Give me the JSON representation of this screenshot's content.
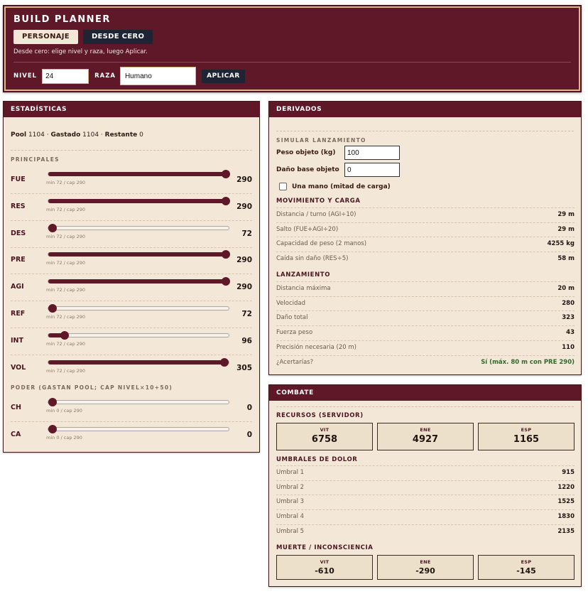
{
  "app": {
    "title": "BUILD PLANNER",
    "mode_personaje": "PERSONAJE",
    "mode_desde_cero": "DESDE CERO",
    "hint": "Desde cero: elige nivel y raza, luego Aplicar.",
    "level_label": "NIVEL",
    "level_value": "24",
    "race_label": "RAZA",
    "race_value": "Humano",
    "apply_label": "APLICAR"
  },
  "stats": {
    "header": "ESTADÍSTICAS",
    "pool_label": "Pool",
    "pool_value": "1104",
    "spent_label": "Gastado",
    "spent_value": "1104",
    "remaining_label": "Restante",
    "remaining_value": "0",
    "main_heading": "PRINCIPALES",
    "power_heading": "PODER (GASTAN POOL; CAP NIVEL×10+50)",
    "main": [
      {
        "name": "FUE",
        "sub": "min 72 / cap 290",
        "value": "290",
        "fraction": 1.0
      },
      {
        "name": "RES",
        "sub": "min 72 / cap 290",
        "value": "290",
        "fraction": 1.0
      },
      {
        "name": "DES",
        "sub": "min 72 / cap 290",
        "value": "72",
        "fraction": 0.0
      },
      {
        "name": "PRE",
        "sub": "min 72 / cap 290",
        "value": "290",
        "fraction": 1.0
      },
      {
        "name": "AGI",
        "sub": "min 72 / cap 290",
        "value": "290",
        "fraction": 1.0
      },
      {
        "name": "REF",
        "sub": "min 72 / cap 290",
        "value": "72",
        "fraction": 0.0
      },
      {
        "name": "INT",
        "sub": "min 72 / cap 290",
        "value": "96",
        "fraction": 0.09
      },
      {
        "name": "VOL",
        "sub": "min 72 / cap 290",
        "value": "305",
        "fraction": 0.97
      }
    ],
    "power": [
      {
        "name": "CH",
        "sub": "min 0 / cap 290",
        "value": "0",
        "fraction": 0.0
      },
      {
        "name": "CA",
        "sub": "min 0 / cap 290",
        "value": "0",
        "fraction": 0.0
      }
    ]
  },
  "derived": {
    "header": "DERIVADOS",
    "sim_heading": "SIMULAR LANZAMIENTO",
    "weight_label": "Peso objeto (kg)",
    "weight_value": "100",
    "damage_label": "Daño base objeto",
    "damage_value": "0",
    "one_hand_label": "Una mano (mitad de carga)",
    "movement_heading": "MOVIMIENTO Y CARGA",
    "movement": [
      {
        "key": "Distancia / turno (AGI÷10)",
        "value": "29 m"
      },
      {
        "key": "Salto (FUE+AGI÷20)",
        "value": "29 m"
      },
      {
        "key": "Capacidad de peso (2 manos)",
        "value": "4255 kg"
      },
      {
        "key": "Caída sin daño (RES÷5)",
        "value": "58 m"
      }
    ],
    "launch_heading": "LANZAMIENTO",
    "launch": [
      {
        "key": "Distancia máxima",
        "value": "20 m"
      },
      {
        "key": "Velocidad",
        "value": "280"
      },
      {
        "key": "Daño total",
        "value": "323"
      },
      {
        "key": "Fuerza peso",
        "value": "43"
      },
      {
        "key": "Precisión necesaria (20 m)",
        "value": "110"
      },
      {
        "key": "¿Acertarías?",
        "value": "Sí (máx. 80 m con PRE 290)"
      }
    ]
  },
  "combat": {
    "header": "COMBATE",
    "resources_heading": "RECURSOS (SERVIDOR)",
    "resources": [
      {
        "label": "VIT",
        "value": "6758"
      },
      {
        "label": "ENE",
        "value": "4927"
      },
      {
        "label": "ESP",
        "value": "1165"
      }
    ],
    "pain_heading": "UMBRALES DE DOLOR",
    "pain": [
      {
        "key": "Umbral 1",
        "value": "915"
      },
      {
        "key": "Umbral 2",
        "value": "1220"
      },
      {
        "key": "Umbral 3",
        "value": "1525"
      },
      {
        "key": "Umbral 4",
        "value": "1830"
      },
      {
        "key": "Umbral 5",
        "value": "2135"
      }
    ],
    "death_heading": "MUERTE / INCONSCIENCIA",
    "death": [
      {
        "label": "VIT",
        "value": "-610"
      },
      {
        "label": "ENE",
        "value": "-290"
      },
      {
        "label": "ESP",
        "value": "-145"
      }
    ]
  }
}
